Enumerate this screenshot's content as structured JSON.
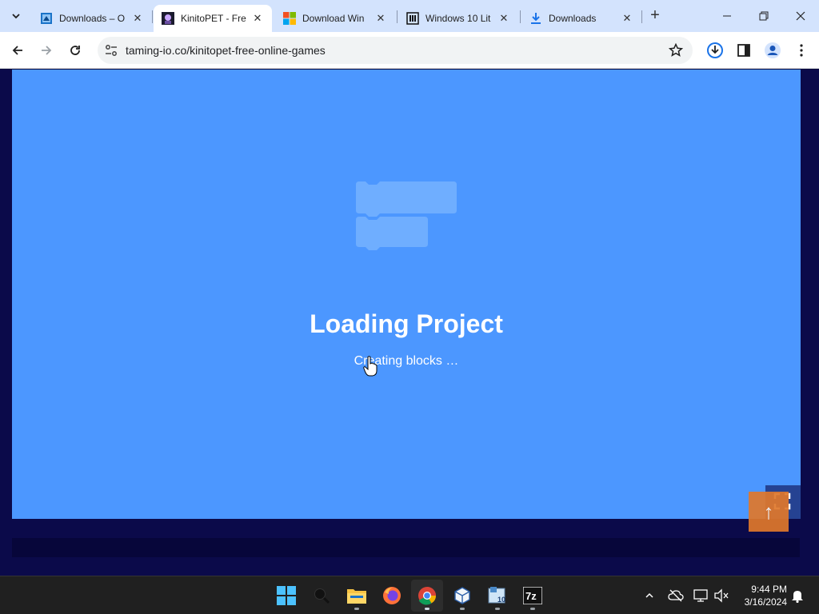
{
  "browser": {
    "tabs": [
      {
        "title": "Downloads – O",
        "icon": "downloads-site-icon",
        "active": false
      },
      {
        "title": "KinitoPET - Free",
        "icon": "kinitopet-icon",
        "active": true
      },
      {
        "title": "Download Win",
        "icon": "microsoft-icon",
        "active": false
      },
      {
        "title": "Windows 10 Lit",
        "icon": "archive-icon",
        "active": false
      },
      {
        "title": "Downloads",
        "icon": "download-icon",
        "active": false
      }
    ],
    "url": "taming-io.co/kinitopet-free-online-games"
  },
  "page": {
    "loading_title": "Loading Project",
    "loading_subtitle": "Creating blocks …",
    "stage_color": "#4c97ff",
    "scroll_top_color": "#e0782b"
  },
  "taskbar": {
    "apps": [
      "start-icon",
      "search-icon",
      "file-explorer-icon",
      "firefox-icon",
      "chrome-icon",
      "virtualbox-icon",
      "windows-10-lite-icon",
      "7zip-icon"
    ],
    "time": "9:44 PM",
    "date": "3/16/2024"
  },
  "colors": {
    "tabstrip": "#d3e3fd",
    "page_background": "#0b0a4a",
    "taskbar": "#202020"
  }
}
